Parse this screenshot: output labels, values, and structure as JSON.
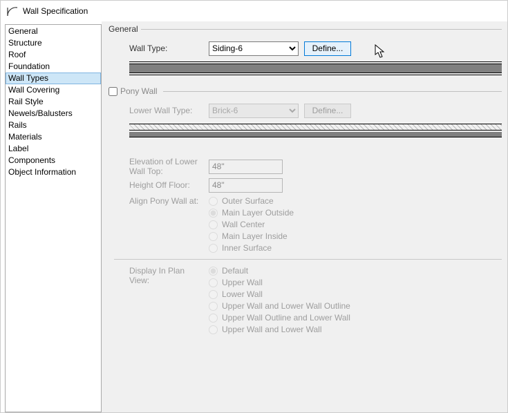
{
  "window": {
    "title": "Wall Specification"
  },
  "sidebar": {
    "items": [
      {
        "label": "General"
      },
      {
        "label": "Structure"
      },
      {
        "label": "Roof"
      },
      {
        "label": "Foundation"
      },
      {
        "label": "Wall Types",
        "selected": true
      },
      {
        "label": "Wall Covering"
      },
      {
        "label": "Rail Style"
      },
      {
        "label": "Newels/Balusters"
      },
      {
        "label": "Rails"
      },
      {
        "label": "Materials"
      },
      {
        "label": "Label"
      },
      {
        "label": "Components"
      },
      {
        "label": "Object Information"
      }
    ]
  },
  "general": {
    "legend": "General",
    "wall_type_label": "Wall Type:",
    "wall_type_value": "Siding-6",
    "define_label": "Define..."
  },
  "pony": {
    "legend": "Pony Wall",
    "checked": false,
    "lower_wall_type_label": "Lower Wall Type:",
    "lower_wall_type_value": "Brick-6",
    "define_label": "Define...",
    "elev_label": "Elevation of Lower Wall Top:",
    "elev_value": "48\"",
    "height_label": "Height Off Floor:",
    "height_value": "48\"",
    "align_label": "Align Pony Wall at:",
    "align_options": [
      "Outer Surface",
      "Main Layer Outside",
      "Wall Center",
      "Main Layer Inside",
      "Inner Surface"
    ],
    "align_selected_index": 1,
    "display_label": "Display In Plan View:",
    "display_options": [
      "Default",
      "Upper Wall",
      "Lower Wall",
      "Upper Wall and Lower Wall Outline",
      "Upper Wall Outline and Lower Wall",
      "Upper Wall and Lower Wall"
    ],
    "display_selected_index": 0
  }
}
